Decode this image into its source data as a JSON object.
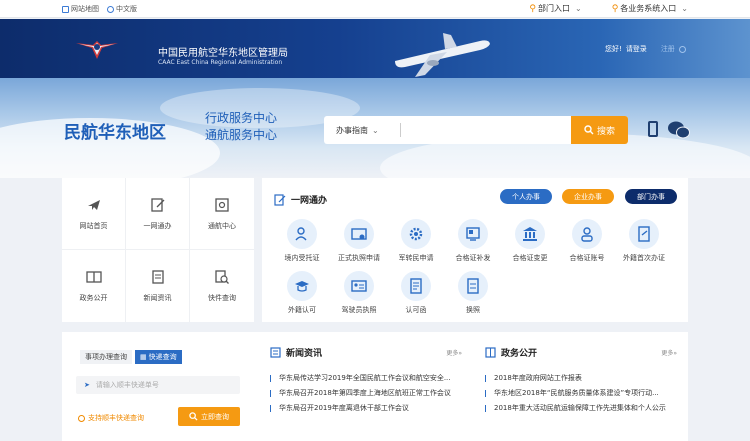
{
  "topbar": {
    "sitemap": "网站地图",
    "lang": "中文版",
    "dept_entry": "部门入口",
    "biz_entry": "各业务系统入口"
  },
  "header": {
    "title": "中国民用航空华东地区管理局",
    "subtitle": "CAAC East China Regional Administration",
    "greeting": "您好!",
    "login": "请登录",
    "register": "注册"
  },
  "hero": {
    "slogan": "民航华东地区",
    "slogan_line1": "行政服务中心",
    "slogan_line2": "通航服务中心"
  },
  "search": {
    "category": "办事指南",
    "button": "搜索",
    "placeholder": ""
  },
  "left_nav": [
    {
      "label": "网站首页",
      "icon": "plane-icon"
    },
    {
      "label": "一网通办",
      "icon": "edit-doc-icon"
    },
    {
      "label": "通航中心",
      "icon": "window-icon"
    },
    {
      "label": "政务公开",
      "icon": "book-icon"
    },
    {
      "label": "新闻资讯",
      "icon": "news-icon"
    },
    {
      "label": "快件查询",
      "icon": "search-doc-icon"
    }
  ],
  "service": {
    "title": "一网通办",
    "personal": "个人办事",
    "enterprise": "企业办事",
    "department": "部门办事",
    "items": [
      {
        "label": "境内受托证",
        "icon": "person-icon"
      },
      {
        "label": "正式执照申请",
        "icon": "license-icon"
      },
      {
        "label": "军转民申请",
        "icon": "gear-icon"
      },
      {
        "label": "合格证补发",
        "icon": "certificate-icon"
      },
      {
        "label": "合格证变更",
        "icon": "building-icon"
      },
      {
        "label": "合格证账号",
        "icon": "user-icon"
      },
      {
        "label": "外籍首次办证",
        "icon": "passport-icon"
      },
      {
        "label": "外籍认可",
        "icon": "graduation-icon"
      },
      {
        "label": "驾驶员执照",
        "icon": "id-card-icon"
      },
      {
        "label": "认可函",
        "icon": "letter-icon"
      },
      {
        "label": "换照",
        "icon": "swap-doc-icon"
      }
    ]
  },
  "express": {
    "tab1": "事项办理查询",
    "tab2": "快递查询",
    "placeholder": "请输入顺丰快递单号",
    "note": "支持顺丰快递查询",
    "button": "立即查询"
  },
  "news": {
    "title": "新闻资讯",
    "more": "更多»",
    "items": [
      "华东局传达学习2019年全国民航工作会议和航空安全...",
      "华东局召开2018年第四季度上海地区航班正常工作会议",
      "华东局召开2019年度离退休干部工作会议"
    ]
  },
  "public": {
    "title": "政务公开",
    "more": "更多»",
    "items": [
      "2018年度政府网站工作报表",
      "华东地区2018年“民航服务质量体系建设”专项行动...",
      "2018年重大活动民航运输保障工作先进集体和个人公示"
    ]
  },
  "colors": {
    "accent": "#f59a12",
    "primary": "#2b6cc4",
    "header_dark": "#0d2c6b"
  }
}
